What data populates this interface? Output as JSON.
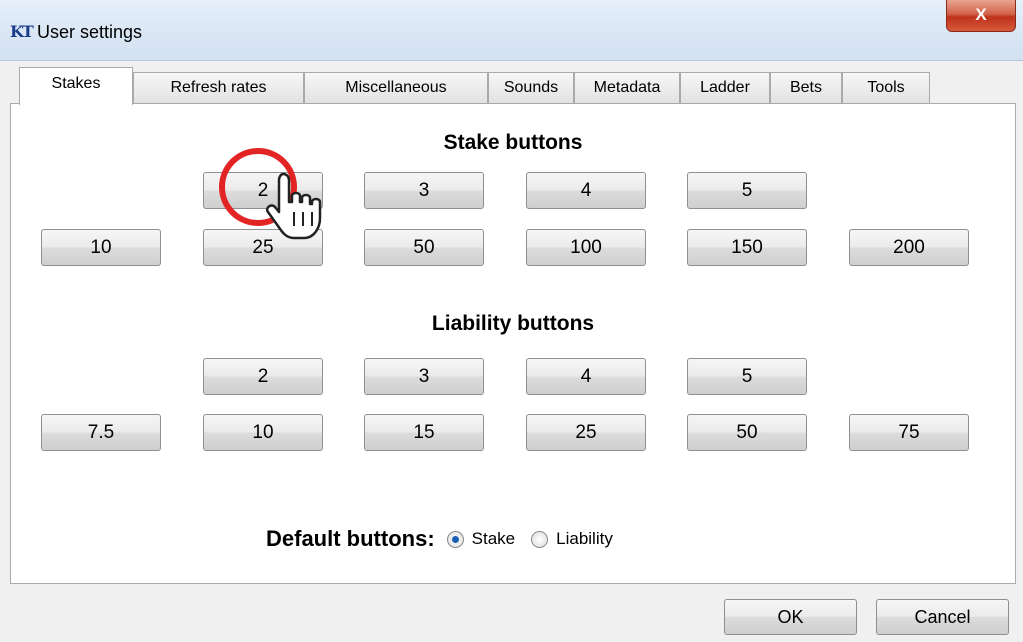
{
  "window": {
    "icon_text": "KT",
    "title": "User settings",
    "close_glyph": "X"
  },
  "tabs": [
    {
      "label": "Stakes",
      "active": true
    },
    {
      "label": "Refresh rates"
    },
    {
      "label": "Miscellaneous"
    },
    {
      "label": "Sounds"
    },
    {
      "label": "Metadata"
    },
    {
      "label": "Ladder"
    },
    {
      "label": "Bets"
    },
    {
      "label": "Tools"
    }
  ],
  "stake": {
    "title": "Stake buttons",
    "row1": [
      "2",
      "3",
      "4",
      "5"
    ],
    "row2": [
      "10",
      "25",
      "50",
      "100",
      "150",
      "200"
    ]
  },
  "liability": {
    "title": "Liability buttons",
    "row1": [
      "2",
      "3",
      "4",
      "5"
    ],
    "row2": [
      "7.5",
      "10",
      "15",
      "25",
      "50",
      "75"
    ]
  },
  "defaults": {
    "label": "Default buttons:",
    "options": [
      {
        "label": "Stake",
        "checked": true
      },
      {
        "label": "Liability",
        "checked": false
      }
    ]
  },
  "footer": {
    "ok": "OK",
    "cancel": "Cancel"
  },
  "overlay": {
    "cursor": "hand-pointer-icon",
    "highlight_color": "#e32424"
  }
}
